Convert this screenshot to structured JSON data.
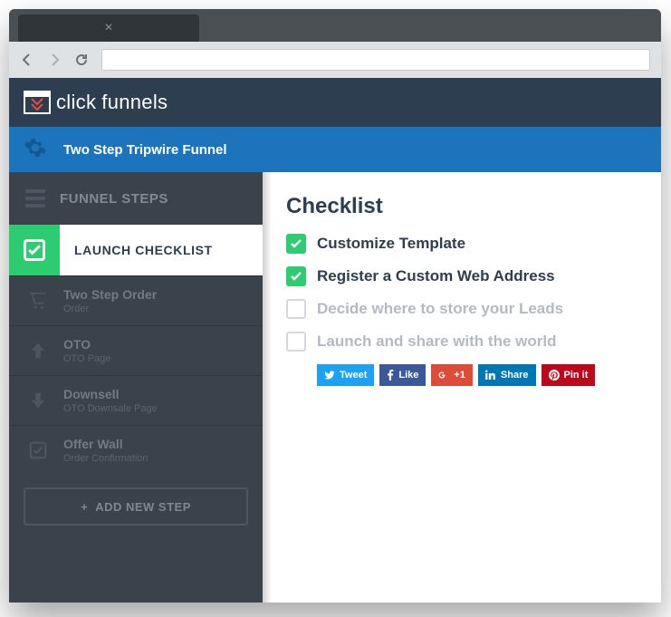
{
  "browser": {
    "tab_close": "×"
  },
  "app": {
    "logo_text_1": "click",
    "logo_text_2": "funnels"
  },
  "titlebar": {
    "title": "Two Step Tripwire Funnel"
  },
  "sidebar": {
    "header": "FUNNEL STEPS",
    "active": "LAUNCH CHECKLIST",
    "items": [
      {
        "title": "Two Step Order",
        "sub": "Order"
      },
      {
        "title": "OTO",
        "sub": "OTO Page"
      },
      {
        "title": "Downsell",
        "sub": "OTO Downsale Page"
      },
      {
        "title": "Offer Wall",
        "sub": "Order Confirmation"
      }
    ],
    "add": "ADD NEW STEP"
  },
  "content": {
    "heading": "Checklist",
    "items": [
      {
        "label": "Customize Template",
        "done": true
      },
      {
        "label": "Register a Custom Web Address",
        "done": true
      },
      {
        "label": "Decide where to store your Leads",
        "done": false
      },
      {
        "label": "Launch and share with the world",
        "done": false
      }
    ],
    "share": {
      "tweet": "Tweet",
      "like": "Like",
      "plus": "+1",
      "share": "Share",
      "pin": "Pin it"
    }
  }
}
